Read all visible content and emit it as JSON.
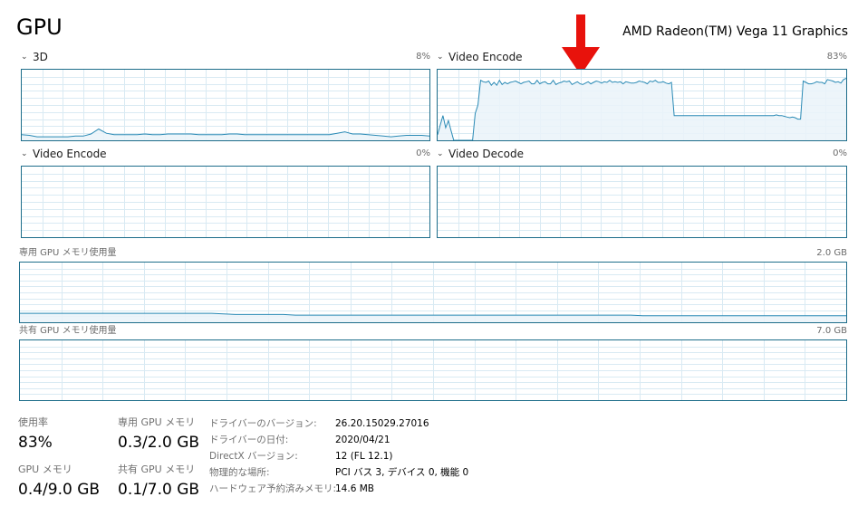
{
  "header": {
    "title": "GPU",
    "gpu_name": "AMD Radeon(TM) Vega 11 Graphics"
  },
  "panels": [
    {
      "name": "3D",
      "percent": "8%",
      "series": [
        8,
        7,
        5,
        5,
        5,
        5,
        5,
        6,
        6,
        9,
        16,
        10,
        8,
        8,
        8,
        8,
        9,
        8,
        8,
        9,
        9,
        9,
        9,
        8,
        8,
        8,
        8,
        9,
        9,
        8,
        8,
        8,
        8,
        8,
        8,
        8,
        8,
        8,
        8,
        8,
        8,
        10,
        12,
        9,
        9,
        8,
        7,
        6,
        5,
        6,
        7,
        7,
        7,
        6
      ]
    },
    {
      "name": "Video Encode",
      "percent": "83%",
      "series": [
        8,
        22,
        35,
        18,
        28,
        14,
        0,
        0,
        0,
        0,
        0,
        0,
        0,
        0,
        38,
        50,
        85,
        83,
        82,
        84,
        78,
        82,
        78,
        85,
        79,
        82,
        80,
        82,
        83,
        84,
        82,
        80,
        82,
        83,
        84,
        80,
        80,
        85,
        80,
        82,
        83,
        80,
        80,
        85,
        79,
        81,
        82,
        84,
        83,
        84,
        79,
        81,
        83,
        80,
        79,
        81,
        83,
        80,
        82,
        84,
        83,
        81,
        83,
        82,
        85,
        82,
        83,
        82,
        83,
        80,
        83,
        82,
        81,
        81,
        82,
        84,
        83,
        82,
        80,
        84,
        83,
        85,
        82,
        82,
        83,
        81,
        80,
        82,
        35,
        35,
        35,
        35,
        35,
        35,
        35,
        35,
        35,
        35,
        35,
        35,
        35,
        35,
        35,
        35,
        35,
        35,
        35,
        35,
        35,
        35,
        35,
        35,
        35,
        35,
        35,
        35,
        35,
        35,
        35,
        35,
        35,
        35,
        35,
        35,
        35,
        35,
        36,
        35,
        35,
        34,
        33,
        32,
        33,
        32,
        30,
        30,
        84,
        82,
        80,
        80,
        81,
        83,
        82,
        82,
        80,
        86,
        85,
        84,
        82,
        83,
        81,
        86,
        88
      ]
    },
    {
      "name": "Video Encode",
      "percent": "0%",
      "series": []
    },
    {
      "name": "Video Decode",
      "percent": "0%",
      "series": []
    }
  ],
  "memory_graphs": [
    {
      "label": "専用 GPU メモリ使用量",
      "max": "2.0 GB",
      "series": [
        15,
        15,
        15,
        15,
        15,
        15,
        15,
        15,
        15,
        15,
        15,
        15,
        15,
        15,
        15,
        15,
        15,
        14,
        13,
        13,
        13,
        13,
        13,
        12,
        12,
        12,
        12,
        12,
        12,
        12,
        12,
        12,
        12,
        12,
        12,
        12,
        12,
        12,
        12,
        12,
        12,
        12,
        12,
        12,
        12,
        12,
        12,
        12,
        12,
        12,
        12,
        12,
        11,
        11,
        11,
        11,
        11,
        11,
        11,
        11,
        11,
        11,
        11,
        11,
        11,
        11,
        11,
        11,
        11,
        11
      ]
    },
    {
      "label": "共有 GPU メモリ使用量",
      "max": "7.0 GB",
      "series": []
    }
  ],
  "stats": [
    {
      "label": "使用率",
      "value": "83%"
    },
    {
      "label": "専用 GPU メモリ",
      "value": "0.3/2.0 GB"
    },
    {
      "label": "GPU メモリ",
      "value": "0.4/9.0 GB"
    },
    {
      "label": "共有 GPU メモリ",
      "value": "0.1/7.0 GB"
    }
  ],
  "info": [
    {
      "label": "ドライバーのバージョン:",
      "value": "26.20.15029.27016"
    },
    {
      "label": "ドライバーの日付:",
      "value": "2020/04/21"
    },
    {
      "label": "DirectX バージョン:",
      "value": "12 (FL 12.1)"
    },
    {
      "label": "物理的な場所:",
      "value": "PCI バス 3, デバイス 0, 機能 0"
    },
    {
      "label": "ハードウェア予約済みメモリ:",
      "value": "14.6 MB"
    }
  ],
  "colors": {
    "accent": "#1d6d8a",
    "line": "#2a8ab5",
    "fill": "#eaf3f9",
    "grid": "#d9eaf3",
    "arrow": "#e8120c"
  }
}
